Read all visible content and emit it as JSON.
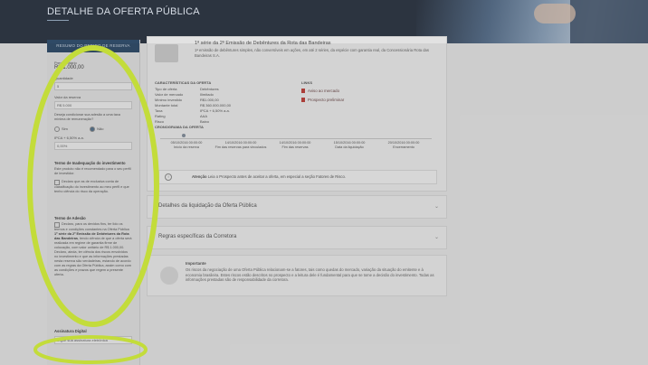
{
  "header": {
    "title": "DETALHE DA OFERTA PÚBLICA"
  },
  "order_panel": {
    "heading": "RESUMO DO PEDIDO DE RESERVA",
    "unit_price_label": "Preço unitário",
    "unit_price_value": "R$ 1.000,00",
    "quantity_label": "Quantidade",
    "quantity_value": "5",
    "reserve_value_label": "Valor da reserva",
    "reserve_value": "R$ 5.000",
    "rate_question": "Deseja condicionar sua adesão a uma taxa mínima de remuneração?",
    "radio_yes": "Sim",
    "radio_no": "Não",
    "rate_reference": "IPCA + 6,50% a.a.",
    "rate_input": "0,00%",
    "adequacy_title": "Termo de Inadequação do investimento",
    "adequacy_text": "Este produto não é recomendado para o seu perfil de investidor.",
    "adequacy_check": "Declaro que as de exclusiva conta de classificação do investimento ao meu perfil e que tenho ciência do risco da operação.",
    "adhesion_title": "Termo de Adesão",
    "adhesion_text_1": "Declaro, para os devidos fins, ter lido os termos e condições constantes na Oferta Pública",
    "adhesion_text_bold": "1ª série da 2ª Emissão de Debêntures da Rota das Bandeiras",
    "adhesion_text_2": ", tendo ciência de que a oferta será realizada em regime de garantia firme de colocação, com valor unitário de R$ 1.000,00. Declaro, ainda, ter ciência dos riscos envolvidos no investimento e que as informações prestadas nesta reserva são verdadeiras, estando de acordo com as regras da Oferta Pública, assim como com as condições e prazos que regem a presente oferta.",
    "digital_sig_title": "Assinatura Digital",
    "digital_sig_text": "Digite sua assinatura eletrônica"
  },
  "offer": {
    "title": "1ª série da 2ª Emissão de Debêntures da Rota das Bandeiras",
    "description": "1ª emissão de debêntures simples, não conversíveis em ações, em até 2 séries, da espécie com garantia real, da Concessionária Rota das Bandeiras S.A.",
    "characteristics_title": "CARACTERÍSTICAS DA OFERTA",
    "characteristics": [
      {
        "k": "Tipo de oferta",
        "v": "Debêntures"
      },
      {
        "k": "Valor de mercado",
        "v": "Ilimitado"
      },
      {
        "k": "Mínimo investido",
        "v": "R$1.000,00"
      },
      {
        "k": "Montante total",
        "v": "R$ 360.000.000,00"
      },
      {
        "k": "Taxa",
        "v": "IPCA + 6,50% a.a."
      },
      {
        "k": "Rating",
        "v": "AAA"
      },
      {
        "k": "Risco",
        "v": "Baixo"
      }
    ],
    "links_title": "LINKS",
    "link_1": "Aviso ao mercado",
    "link_2": "Prospecto preliminar",
    "timeline_title": "CRONOGRAMA DA OFERTA",
    "timeline": [
      {
        "date": "05/10/2016 00:00:00",
        "label": "Início da reserva"
      },
      {
        "date": "14/10/2016 00:00:00",
        "label": "Fim das reservas para vinculados"
      },
      {
        "date": "14/10/2016 00:00:00",
        "label": "Fim das reservas"
      },
      {
        "date": "15/10/2016 00:00:00",
        "label": "Data da liquidação"
      },
      {
        "date": "20/10/2016 00:00:00",
        "label": "Encerramento"
      }
    ],
    "warning_label": "Atenção",
    "warning_text": "Leia o Prospecto antes de aceitar a oferta, em especial a seção Fatores de Risco."
  },
  "accordions": {
    "settlement": "Detalhes da liquidação da Oferta Pública",
    "broker_rules": "Regras específicas da Corretora"
  },
  "important": {
    "title": "Importante",
    "text": "Os riscos da negociação de uma Oferta Pública relacionam-se a fatores, tais como quedas do mercado, variação da situação do emitente e à economia brasileira. Estes riscos estão descritos no prospecto e a leitura dele é fundamental para que se tome a decisão do investimento. Todas as informações prestadas são de responsabilidade da corretora."
  }
}
